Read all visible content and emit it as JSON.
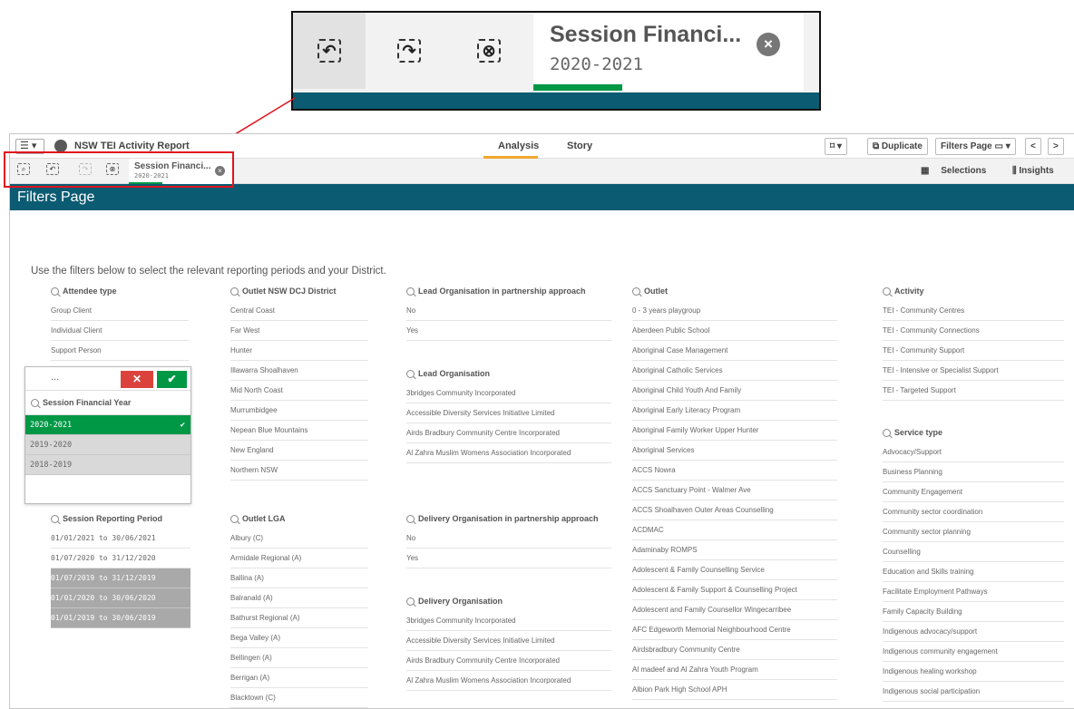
{
  "zoom": {
    "selection_title": "Session Financi...",
    "selection_value": "2020-2021",
    "close_glyph": "×"
  },
  "topbar": {
    "menu_label": "☰ ▾",
    "app_title": "NSW TEI Activity Report",
    "tab_analysis": "Analysis",
    "tab_story": "Story",
    "bookmark_label": "⌑ ▾",
    "duplicate_label": "Duplicate",
    "sheet_selector_label": "Filters Page ▭ ▾",
    "prev_label": "<",
    "next_label": ">"
  },
  "toolbar": {
    "selection_title": "Session Financi...",
    "selection_value": "2020-2021",
    "close_glyph": "×",
    "selections_label": "Selections",
    "insights_label": "Insights"
  },
  "page": {
    "title": "Filters Page",
    "intro": "Use the filters below to select the relevant reporting periods and your District."
  },
  "filters": {
    "attendee_type": {
      "title": "Attendee type",
      "items": [
        "Group Client",
        "Individual Client",
        "Support Person"
      ]
    },
    "session_financial_year": {
      "title": "Session Financial Year",
      "more": "...",
      "cancel_glyph": "✕",
      "confirm_glyph": "✔",
      "tick": "✔",
      "items": [
        "2020-2021",
        "2019-2020",
        "2018-2019"
      ]
    },
    "session_reporting_period": {
      "title": "Session Reporting Period",
      "items": [
        "01/01/2021 to 30/06/2021",
        "01/07/2020 to 31/12/2020",
        "01/07/2019 to 31/12/2019",
        "01/01/2020 to 30/06/2020",
        "01/01/2019 to 30/06/2019"
      ]
    },
    "outlet_district": {
      "title": "Outlet NSW DCJ District",
      "items": [
        "Central Coast",
        "Far West",
        "Hunter",
        "Illawarra Shoalhaven",
        "Mid North Coast",
        "Murrumbidgee",
        "Nepean Blue Mountains",
        "New England",
        "Northern NSW"
      ]
    },
    "outlet_lga": {
      "title": "Outlet LGA",
      "items": [
        "Albury (C)",
        "Armidale Regional (A)",
        "Ballina (A)",
        "Balranald (A)",
        "Bathurst Regional (A)",
        "Bega Valley (A)",
        "Bellingen (A)",
        "Berrigan (A)",
        "Blacktown (C)"
      ]
    },
    "lead_org_partnership": {
      "title": "Lead Organisation in partnership approach",
      "items": [
        "No",
        "Yes"
      ]
    },
    "lead_org": {
      "title": "Lead Organisation",
      "items": [
        "3bridges Community Incorporated",
        "Accessible Diversity Services Initiative Limited",
        "Airds Bradbury Community Centre Incorporated",
        "Al Zahra Muslim Womens Association Incorporated"
      ]
    },
    "delivery_org_partnership": {
      "title": "Delivery Organisation in partnership approach",
      "items": [
        "No",
        "Yes"
      ]
    },
    "delivery_org": {
      "title": "Delivery Organisation",
      "items": [
        "3bridges Community Incorporated",
        "Accessible Diversity Services Initiative Limited",
        "Airds Bradbury Community Centre Incorporated",
        "Al Zahra Muslim Womens Association Incorporated"
      ]
    },
    "outlet": {
      "title": "Outlet",
      "items": [
        "0 - 3 years playgroup",
        "Aberdeen Public School",
        "Aboriginal Case Management",
        "Aboriginal Catholic Services",
        "Aboriginal Child Youth And Family",
        "Aboriginal Early Literacy Program",
        "Aboriginal Family Worker Upper Hunter",
        "Aboriginal Services",
        "ACCS Nowra",
        "ACCS Sanctuary Point - Walmer Ave",
        "ACCS Shoalhaven Outer Areas Counselling",
        "ACDMAC",
        "Adaminaby ROMPS",
        "Adolescent & Family Counselling Service",
        "Adolescent & Family Support & Counselling Project",
        "Adolescent and Family Counsellor Wingecarribee",
        "AFC Edgeworth Memorial Neighbourhood Centre",
        "Airdsbradbury Community Centre",
        "Al madeef and Al Zahra Youth Program",
        "Albion Park High School APH"
      ]
    },
    "activity": {
      "title": "Activity",
      "items": [
        "TEI - Community Centres",
        "TEI - Community Connections",
        "TEI - Community Support",
        "TEI - Intensive or Specialist Support",
        "TEI - Targeted Support"
      ]
    },
    "service_type": {
      "title": "Service type",
      "items": [
        "Advocacy/Support",
        "Business Planning",
        "Community Engagement",
        "Community sector coordination",
        "Community sector planning",
        "Counselling",
        "Education and Skills training",
        "Facilitate Employment Pathways",
        "Family Capacity Building",
        "Indigenous advocacy/support",
        "Indigenous community engagement",
        "Indigenous healing workshop",
        "Indigenous social participation"
      ]
    }
  },
  "colors": {
    "page_bar": "#0b5b72",
    "selected_green": "#009845",
    "cancel_red": "#dc423c",
    "callout_red": "#e0141e",
    "tab_accent": "#f0a82f"
  },
  "icons": [
    "back-icon",
    "forward-icon",
    "clear-all-icon",
    "smart-search-icon",
    "globe-icon",
    "bookmark-icon",
    "duplicate-icon",
    "selections-icon",
    "insights-icon"
  ]
}
